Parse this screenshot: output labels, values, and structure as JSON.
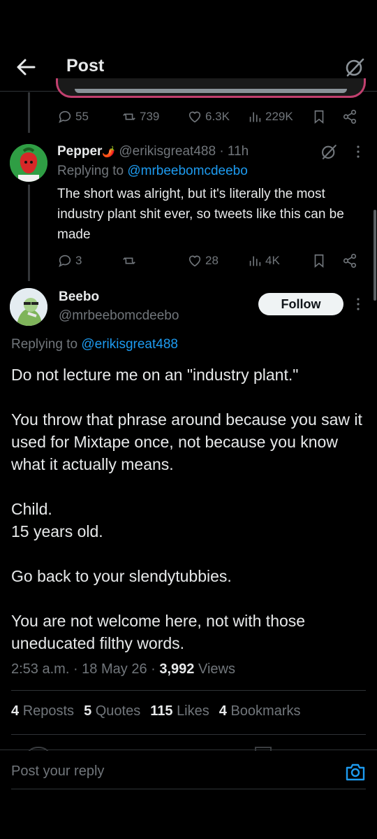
{
  "header": {
    "title": "Post"
  },
  "parent_actions": {
    "replies": "55",
    "reposts": "739",
    "likes": "6.3K",
    "views": "229K"
  },
  "reply": {
    "display_name": "Pepper",
    "name_emoji": "🌶️",
    "handle": "@erikisgreat488",
    "time": "· 11h",
    "replying_prefix": "Replying to",
    "replying_to": "@mrbeebomcdeebo",
    "text": "The short was alright, but it's literally the most industry plant shit ever, so tweets like this can be made",
    "actions": {
      "replies": "3",
      "reposts": "",
      "likes": "28",
      "views": "4K"
    }
  },
  "main_post": {
    "display_name": "Beebo",
    "handle": "@mrbeebomcdeebo",
    "follow_label": "Follow",
    "replying_prefix": "Replying to",
    "replying_to": "@erikisgreat488",
    "lines": [
      "Do not lecture me on an \"industry plant.\"",
      "You throw that phrase around because you saw it used for Mixtape once, not because you know what it actually means.",
      "Child.",
      "15 years old.",
      "Go back to your slendytubbies.",
      "You are not welcome here, not with those uneducated filthy words."
    ],
    "time": "2:53 a.m.",
    "date": "18 May 26",
    "views_count": "3,992",
    "views_label": "Views"
  },
  "stats": {
    "reposts_count": "4",
    "reposts_label": "Reposts",
    "quotes_count": "5",
    "quotes_label": "Quotes",
    "likes_count": "115",
    "likes_label": "Likes",
    "bookmarks_count": "4",
    "bookmarks_label": "Bookmarks"
  },
  "composer": {
    "placeholder": "Post your reply"
  },
  "colors": {
    "accent": "#1d9bf0",
    "background": "#000000",
    "muted": "#71767b",
    "text": "#e7e9ea"
  }
}
